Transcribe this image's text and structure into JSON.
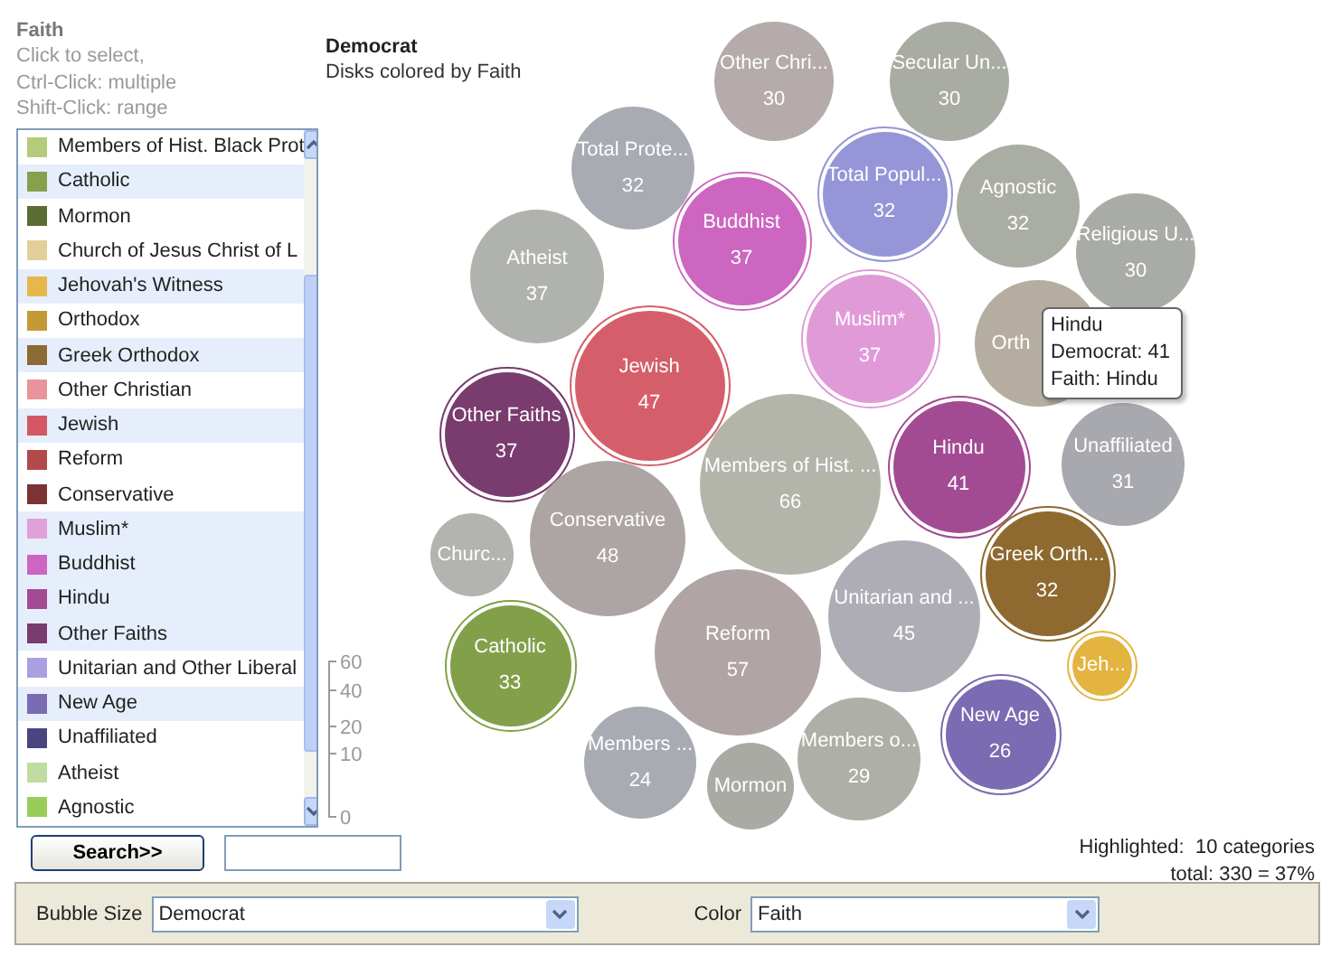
{
  "filter_panel": {
    "title": "Faith",
    "instructions": [
      "Click to select,",
      "Ctrl-Click: multiple",
      "Shift-Click: range"
    ],
    "items": [
      {
        "label": "Members of Hist. Black Prot",
        "color": "#b3cc7a",
        "selected": false
      },
      {
        "label": "Catholic",
        "color": "#86a04e",
        "selected": true
      },
      {
        "label": "Mormon",
        "color": "#5a6e33",
        "selected": false
      },
      {
        "label": "Church of Jesus Christ of L",
        "color": "#e3cf9a",
        "selected": false
      },
      {
        "label": "Jehovah's Witness",
        "color": "#e6b84c",
        "selected": true
      },
      {
        "label": "Orthodox",
        "color": "#c49a36",
        "selected": false
      },
      {
        "label": "Greek Orthodox",
        "color": "#8b6a33",
        "selected": true
      },
      {
        "label": "Other Christian",
        "color": "#e8949a",
        "selected": false
      },
      {
        "label": "Jewish",
        "color": "#d45766",
        "selected": true
      },
      {
        "label": "Reform",
        "color": "#b34a4a",
        "selected": false
      },
      {
        "label": "Conservative",
        "color": "#7a3434",
        "selected": false
      },
      {
        "label": "Muslim*",
        "color": "#e0a0d8",
        "selected": true
      },
      {
        "label": "Buddhist",
        "color": "#cc66c0",
        "selected": true
      },
      {
        "label": "Hindu",
        "color": "#a24b93",
        "selected": true
      },
      {
        "label": "Other Faiths",
        "color": "#7a3b6e",
        "selected": true
      },
      {
        "label": "Unitarian and Other Liberal",
        "color": "#a8a0e0",
        "selected": false
      },
      {
        "label": "New Age",
        "color": "#7a6bb2",
        "selected": true
      },
      {
        "label": "Unaffiliated",
        "color": "#4a4580",
        "selected": false
      },
      {
        "label": "Atheist",
        "color": "#c0dca0",
        "selected": false
      },
      {
        "label": "Agnostic",
        "color": "#9acc5a",
        "selected": false
      }
    ],
    "search_button": "Search>>"
  },
  "chart": {
    "title": "Democrat",
    "subtitle": "Disks colored by Faith",
    "size_legend_ticks": [
      "60",
      "40",
      "20",
      "10",
      "0"
    ],
    "bubbles": [
      {
        "label": "Other Chri...",
        "value": "30",
        "color": "#b5abab",
        "highlighted": false
      },
      {
        "label": "Secular Un...",
        "value": "30",
        "color": "#a9aca3",
        "highlighted": false
      },
      {
        "label": "Total Prote...",
        "value": "32",
        "color": "#a9abb3",
        "highlighted": false
      },
      {
        "label": "Total Popul...",
        "value": "32",
        "color": "#9595d8",
        "highlighted": true
      },
      {
        "label": "Agnostic",
        "value": "32",
        "color": "#a9ada3",
        "highlighted": false
      },
      {
        "label": "Religious U...",
        "value": "30",
        "color": "#a9aca6",
        "highlighted": false
      },
      {
        "label": "Buddhist",
        "value": "37",
        "color": "#cc66c0",
        "highlighted": true
      },
      {
        "label": "Atheist",
        "value": "37",
        "color": "#b0b3ad",
        "highlighted": false
      },
      {
        "label": "Muslim*",
        "value": "37",
        "color": "#e09ad8",
        "highlighted": true
      },
      {
        "label": "Orth",
        "color": "#b5aea0",
        "highlighted": false
      },
      {
        "label": "Jewish",
        "value": "47",
        "color": "#d45f6a",
        "highlighted": true
      },
      {
        "label": "Other Faiths",
        "value": "37",
        "color": "#7a3b6e",
        "highlighted": true
      },
      {
        "label": "Members of Hist. ...",
        "value": "66",
        "color": "#b3b5ab",
        "highlighted": false
      },
      {
        "label": "Hindu",
        "value": "41",
        "color": "#a24b93",
        "highlighted": true
      },
      {
        "label": "Unaffiliated",
        "value": "31",
        "color": "#a8a9ae",
        "highlighted": false
      },
      {
        "label": "Churc...",
        "color": "#b3b3b0",
        "highlighted": false
      },
      {
        "label": "Conservative",
        "value": "48",
        "color": "#ada4a4",
        "highlighted": false
      },
      {
        "label": "Catholic",
        "value": "33",
        "color": "#82a04a",
        "highlighted": true
      },
      {
        "label": "Reform",
        "value": "57",
        "color": "#b0a4a4",
        "highlighted": false
      },
      {
        "label": "Unitarian and ...",
        "value": "45",
        "color": "#aeadb6",
        "highlighted": false
      },
      {
        "label": "Greek Orth...",
        "value": "32",
        "color": "#8e6a30",
        "highlighted": true
      },
      {
        "label": "Jeh...",
        "color": "#e3b440",
        "highlighted": true
      },
      {
        "label": "New Age",
        "value": "26",
        "color": "#7a6bb2",
        "highlighted": true
      },
      {
        "label": "Members ...",
        "value": "24",
        "color": "#a9abb3",
        "highlighted": false
      },
      {
        "label": "Mormon",
        "color": "#a9aaa3",
        "highlighted": false
      },
      {
        "label": "Members o...",
        "value": "29",
        "color": "#aeafa6",
        "highlighted": false
      }
    ],
    "tooltip": [
      "Hindu",
      "Democrat: 41",
      "Faith: Hindu"
    ],
    "highlighted_summary": "Highlighted:  10 categories",
    "total": "total: 330 = 37%"
  },
  "settings_bar": {
    "bubble_size": {
      "label": "Bubble Size",
      "value": "Democrat"
    },
    "color": {
      "label": "Color",
      "value": "Faith"
    }
  }
}
